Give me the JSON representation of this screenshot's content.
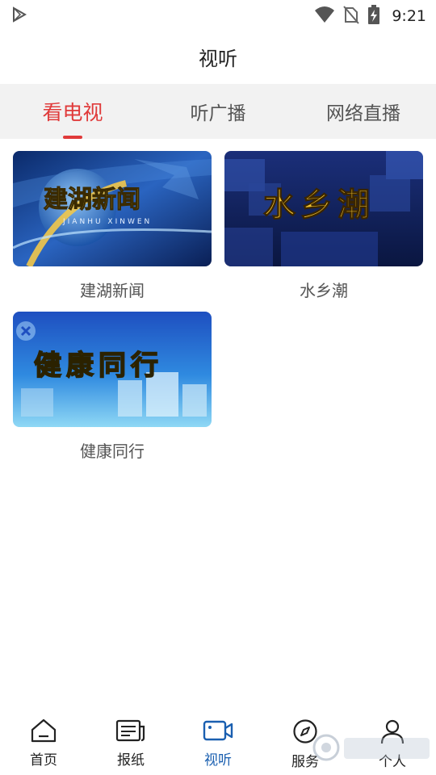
{
  "status_bar": {
    "time": "9:21",
    "icons": [
      "play-store-icon",
      "wifi-icon",
      "no-sim-icon",
      "battery-charging-icon"
    ]
  },
  "header": {
    "title": "视听"
  },
  "tabs": [
    {
      "label": "看电视",
      "active": true
    },
    {
      "label": "听广播",
      "active": false
    },
    {
      "label": "网络直播",
      "active": false
    }
  ],
  "programs": [
    {
      "name": "建湖新闻",
      "thumb_title": "建湖新闻",
      "thumb_subtitle": "JIANHU XINWEN"
    },
    {
      "name": "水乡潮",
      "thumb_title": "水乡潮"
    },
    {
      "name": "健康同行",
      "thumb_title": "健康同行"
    }
  ],
  "bottom_nav": [
    {
      "label": "首页",
      "icon": "home-icon",
      "active": false
    },
    {
      "label": "报纸",
      "icon": "newspaper-icon",
      "active": false
    },
    {
      "label": "视听",
      "icon": "video-camera-icon",
      "active": true
    },
    {
      "label": "服务",
      "icon": "compass-icon",
      "active": false
    },
    {
      "label": "个人",
      "icon": "person-icon",
      "active": false
    }
  ],
  "colors": {
    "accent": "#e03a3a",
    "nav_active": "#1a5fb0",
    "tab_bg": "#f2f2f2"
  }
}
